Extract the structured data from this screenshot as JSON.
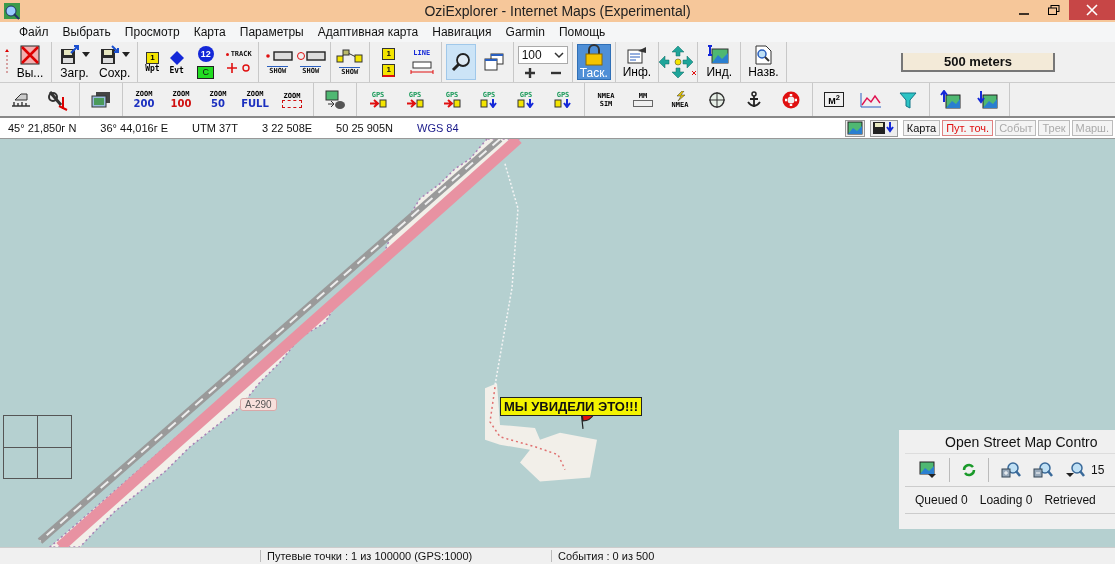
{
  "window": {
    "title": "OziExplorer - Internet Maps (Experimental)"
  },
  "menu": [
    "Файл",
    "Выбрать",
    "Просмотр",
    "Карта",
    "Параметры",
    "Адаптивная карта",
    "Навигация",
    "Garmin",
    "Помощь"
  ],
  "toolbar_main": [
    [
      {
        "kind": "grip"
      },
      {
        "kind": "unload",
        "label": "Вы..."
      }
    ],
    [
      {
        "kind": "load",
        "label": "Загр.",
        "dropdown": true
      },
      {
        "kind": "save",
        "label": "Сохр.",
        "dropdown": true
      }
    ],
    [
      {
        "kind": "wpt",
        "badge": "1",
        "label": "Wpt"
      },
      {
        "kind": "evt",
        "label": "Evt"
      },
      {
        "kind": "stack",
        "items": [
          {
            "kind": "circle-badge",
            "text": "12"
          },
          {
            "kind": "green-badge",
            "text": "C"
          }
        ]
      },
      {
        "kind": "stack",
        "items": [
          {
            "kind": "track",
            "text": "TRACK"
          },
          {
            "kind": "plus-circle"
          }
        ]
      }
    ],
    [
      {
        "kind": "stack",
        "items": [
          {
            "kind": "dot-bar"
          },
          {
            "kind": "show-wave",
            "text": "SHOW"
          }
        ]
      },
      {
        "kind": "stack",
        "items": [
          {
            "kind": "circle-bar"
          },
          {
            "kind": "show-dots",
            "text": "SHOW"
          }
        ]
      }
    ],
    [
      {
        "kind": "stack",
        "items": [
          {
            "kind": "route"
          },
          {
            "kind": "show-route",
            "text": "SHOW"
          }
        ]
      }
    ],
    [
      {
        "kind": "stack",
        "items": [
          {
            "kind": "wpt-copy",
            "text": "1"
          },
          {
            "kind": "wpt-measure",
            "text": "1"
          }
        ]
      },
      {
        "kind": "stack",
        "items": [
          {
            "kind": "line",
            "text": "LINE"
          },
          {
            "kind": "measure"
          }
        ]
      }
    ],
    [
      {
        "kind": "magnifier",
        "selected": true
      },
      {
        "kind": "windows",
        "selected": false
      }
    ],
    [
      {
        "kind": "combo",
        "value": "100"
      }
    ],
    [
      {
        "kind": "lock",
        "label": "Таск.",
        "selected": true
      }
    ],
    [
      {
        "kind": "info",
        "label": "Инф."
      }
    ],
    [
      {
        "kind": "pad"
      }
    ],
    [
      {
        "kind": "index",
        "label": "Инд."
      }
    ],
    [
      {
        "kind": "names",
        "label": "Назв."
      }
    ]
  ],
  "scale": "500 meters",
  "toolbar_second": [
    [
      {
        "kind": "ruler"
      },
      {
        "kind": "tools"
      }
    ],
    [
      {
        "kind": "monitor"
      }
    ],
    [
      {
        "kind": "zoom",
        "lines": [
          "ZOOM",
          "200"
        ],
        "color": "#1a2fbf"
      },
      {
        "kind": "zoom",
        "lines": [
          "ZOOM",
          "100"
        ],
        "color": "#d01010"
      },
      {
        "kind": "zoom",
        "lines": [
          "ZOOM",
          "50"
        ],
        "color": "#1a2fbf"
      },
      {
        "kind": "zoom",
        "lines": [
          "ZOOM",
          "FULL"
        ],
        "color": "#1a2fbf"
      },
      {
        "kind": "zoom-rect",
        "lines": [
          "ZOOM"
        ],
        "color": "#d01010"
      }
    ],
    [
      {
        "kind": "print"
      }
    ],
    [
      {
        "kind": "gps-send",
        "lines": [
          "GPS"
        ]
      },
      {
        "kind": "gps-send",
        "lines": [
          "GPS"
        ]
      },
      {
        "kind": "gps-send",
        "lines": [
          "GPS"
        ]
      },
      {
        "kind": "gps-get",
        "lines": [
          "GPS"
        ]
      },
      {
        "kind": "gps-get",
        "lines": [
          "GPS"
        ]
      },
      {
        "kind": "gps-get",
        "lines": [
          "GPS"
        ]
      }
    ],
    [
      {
        "kind": "text-icon",
        "lines": [
          "NMEA",
          "SIM"
        ]
      },
      {
        "kind": "mm",
        "lines": [
          "MM"
        ]
      },
      {
        "kind": "bolt",
        "lines": [
          "NMEA"
        ]
      },
      {
        "kind": "crosshair"
      },
      {
        "kind": "anchor"
      },
      {
        "kind": "lifebuoy"
      }
    ],
    [
      {
        "kind": "area",
        "lines": [
          "M$^{2}$"
        ]
      },
      {
        "kind": "chart"
      },
      {
        "kind": "funnel"
      }
    ],
    [
      {
        "kind": "map-up"
      },
      {
        "kind": "map-down"
      }
    ]
  ],
  "coords": [
    {
      "text": "45° 21,850г N",
      "kind": "plain"
    },
    {
      "text": "36° 44,016г E",
      "kind": "plain"
    },
    {
      "text": "UTM  37T",
      "kind": "plain"
    },
    {
      "text": "3 22 508E",
      "kind": "plain"
    },
    {
      "text": "50 25 905N",
      "kind": "plain"
    },
    {
      "text": "WGS 84",
      "kind": "datum"
    }
  ],
  "view_tabs": [
    {
      "label": "Карта",
      "selected": false,
      "disabled": false
    },
    {
      "label": "Пут. точ.",
      "selected": true,
      "disabled": false
    },
    {
      "label": "Событ",
      "selected": false,
      "disabled": true
    },
    {
      "label": "Трек",
      "selected": false,
      "disabled": true
    },
    {
      "label": "Марш.",
      "selected": false,
      "disabled": true
    }
  ],
  "map": {
    "road_label": "A-290",
    "waypoint_label": "МЫ УВИДЕЛИ ЭТО!!!"
  },
  "osm_control": {
    "title": "Open Street Map Contro",
    "zoom": "15",
    "stats": [
      "Queued  0",
      "Loading  0",
      "Retrieved"
    ]
  },
  "status_bar": [
    "Путевые точки : 1 из 100000  (GPS:1000)",
    "События : 0 из 500"
  ]
}
